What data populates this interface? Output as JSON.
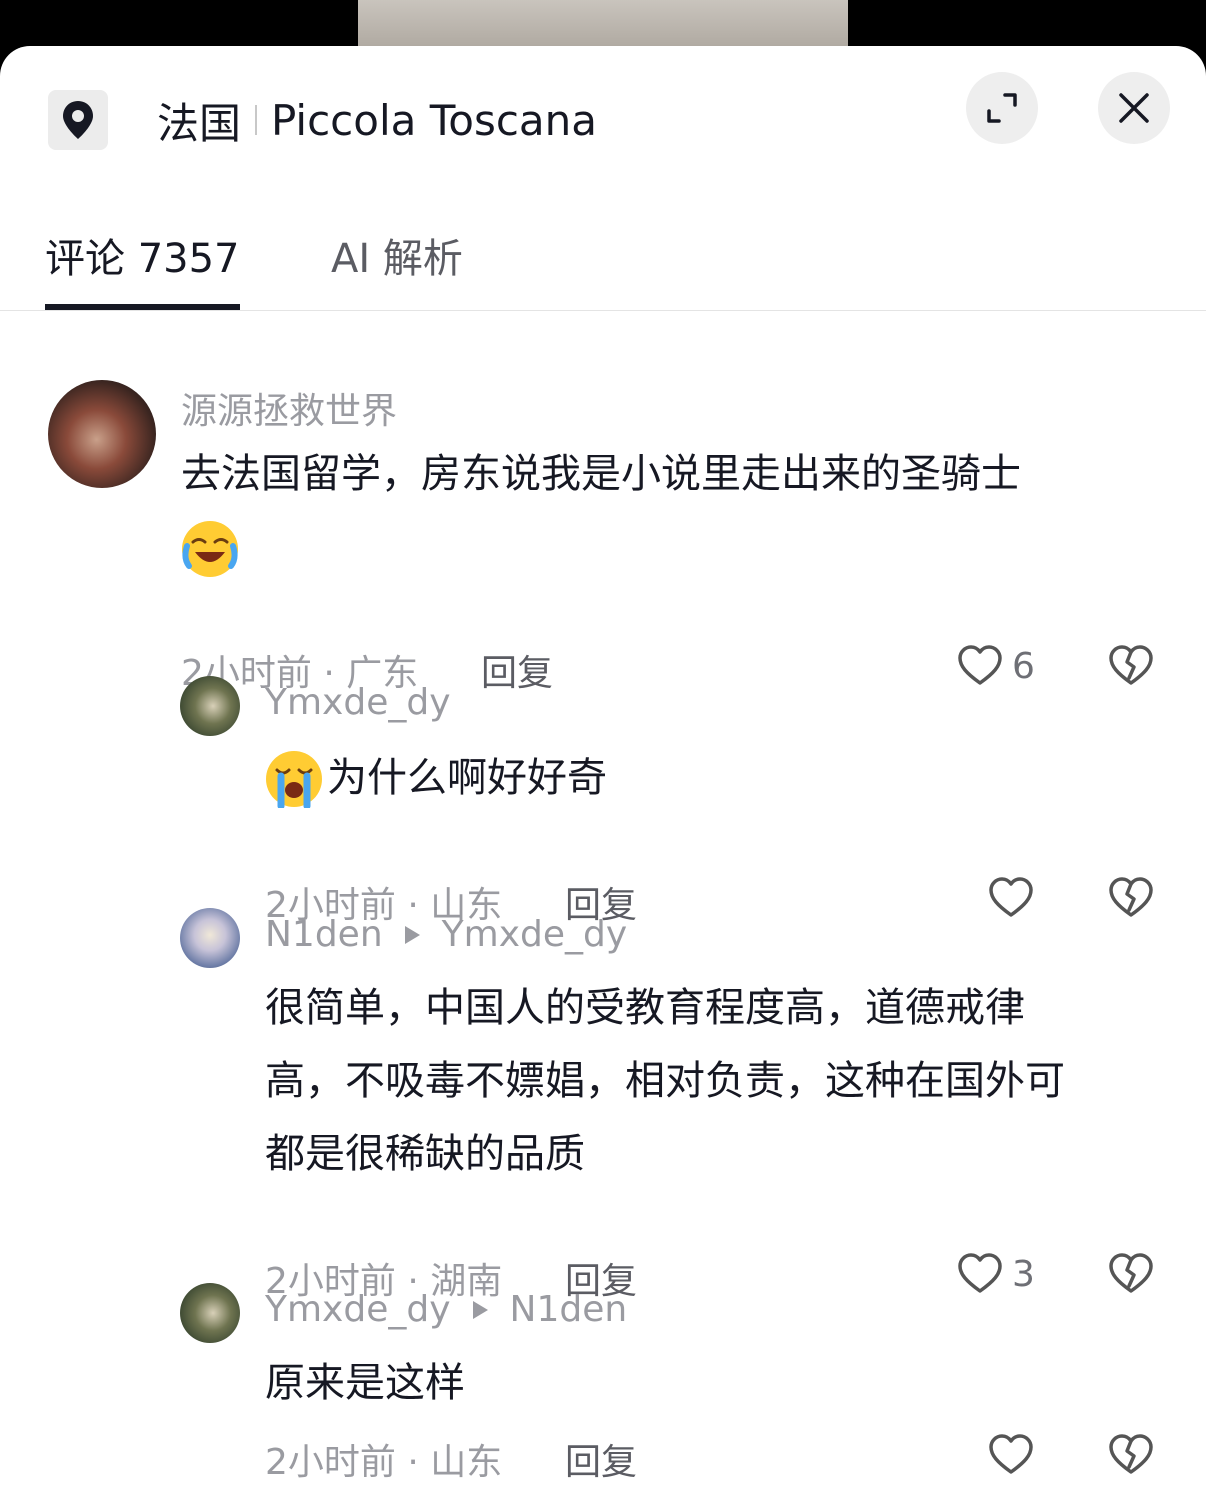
{
  "header": {
    "country": "法国",
    "place": "Piccola Toscana"
  },
  "tabs": [
    {
      "label": "评论 7357",
      "active": true
    },
    {
      "label": "AI 解析",
      "active": false
    }
  ],
  "comments": [
    {
      "user": "源源拯救世界",
      "text": "去法国留学，房东说我是小说里走出来的圣骑士",
      "emoji": "laughing-crying-emoji",
      "time_loc": "2小时前 · 广东",
      "reply_label": "回复",
      "likes": "6"
    },
    {
      "user": "Ymxde_dy",
      "text": "为什么啊好好奇",
      "emoji": "crying-emoji",
      "time_loc": "2小时前 · 山东",
      "reply_label": "回复",
      "likes": ""
    },
    {
      "user": "N1den",
      "reply_to": "Ymxde_dy",
      "text_lines": [
        "很简单，中国人的受教育程度高，道德戒律",
        "高，不吸毒不嫖娼，相对负责，这种在国外可",
        "都是很稀缺的品质"
      ],
      "time_loc": "2小时前 · 湖南",
      "reply_label": "回复",
      "likes": "3"
    },
    {
      "user": "Ymxde_dy",
      "reply_to": "N1den",
      "text": "原来是这样",
      "time_loc": "2小时前 · 山东",
      "reply_label": "回复",
      "likes": ""
    }
  ],
  "colors": {
    "primary_text": "#161823",
    "secondary_text": "#9a9ba1",
    "icon": "#555555"
  }
}
